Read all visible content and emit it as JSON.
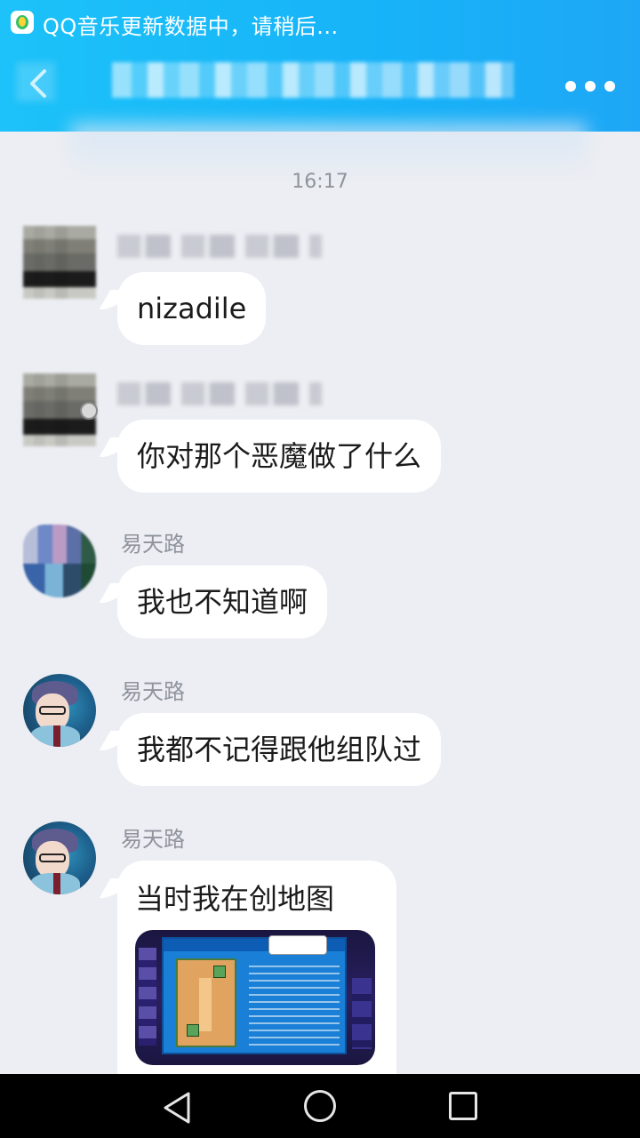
{
  "status_bar": {
    "notification_text": "QQ音乐更新数据中，请稍后..."
  },
  "header": {
    "title_obscured": true
  },
  "chat": {
    "timestamp": "16:17",
    "messages": [
      {
        "sender": "",
        "text": "nizadile"
      },
      {
        "sender": "",
        "text": "你对那个恶魔做了什么"
      },
      {
        "sender": "易天路",
        "text": "我也不知道啊"
      },
      {
        "sender": "易天路",
        "text": "我都不记得跟他组队过"
      },
      {
        "sender": "易天路",
        "text": "当时我在创地图"
      }
    ]
  },
  "colors": {
    "header_gradient_start": "#1cc2f9",
    "header_gradient_end": "#1ea7f6",
    "chat_background": "#eceef3",
    "bubble": "#ffffff",
    "meta_text": "#8f939c"
  },
  "icons": {
    "back": "back-arrow-icon",
    "more": "more-dots-icon",
    "nav_back": "triangle-back-icon",
    "nav_home": "circle-home-icon",
    "nav_recent": "square-recent-icon"
  }
}
